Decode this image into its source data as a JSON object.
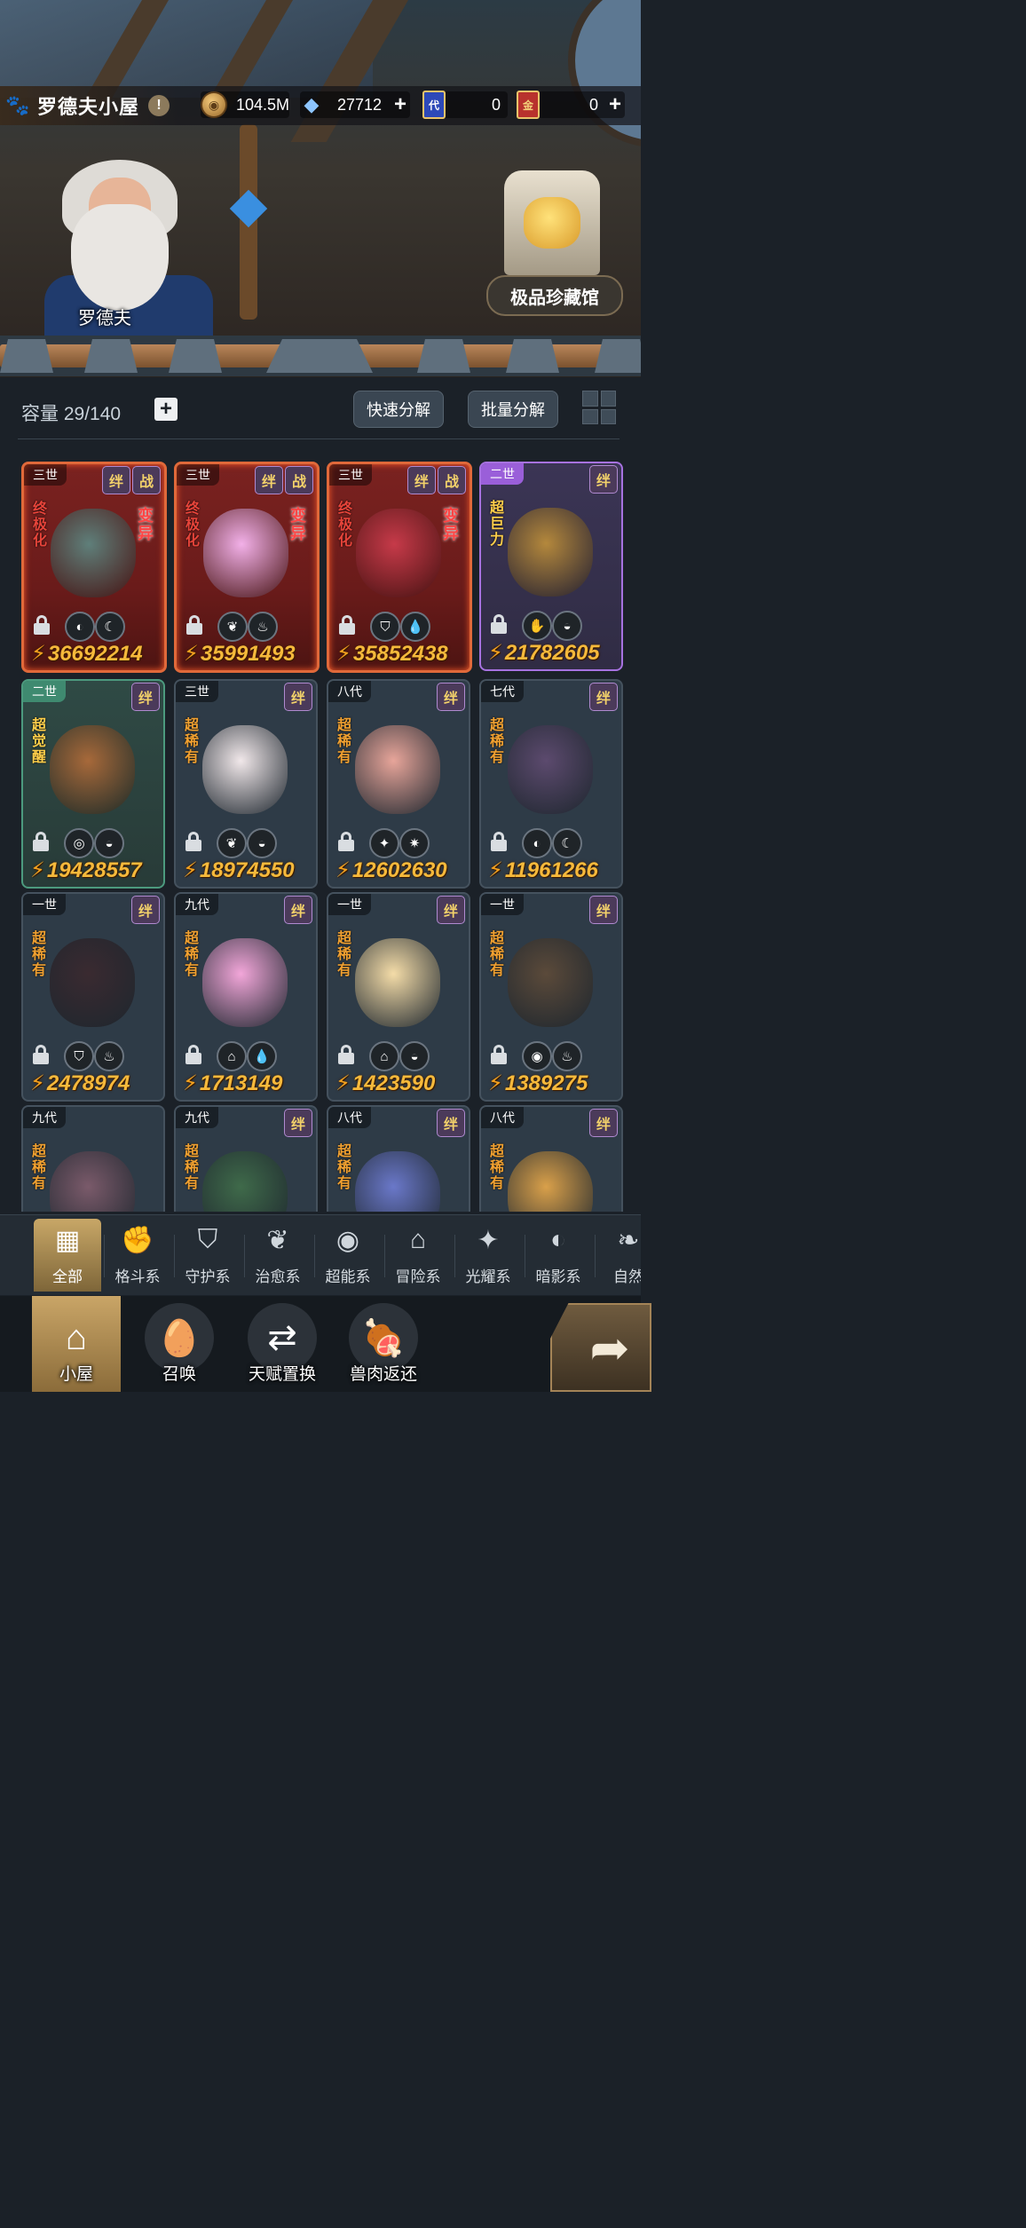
{
  "header": {
    "title": "罗德夫小屋",
    "resources": [
      {
        "name": "gold",
        "value": "104.5M",
        "icon": "gold-coin-icon"
      },
      {
        "name": "crystal",
        "value": "27712",
        "icon": "crystal-icon",
        "plus": "+"
      },
      {
        "name": "blue-ticket",
        "value": "0",
        "icon": "blue-ticket-icon",
        "badge": "代"
      },
      {
        "name": "red-ticket",
        "value": "0",
        "icon": "red-ticket-icon",
        "badge": "金",
        "plus": "+"
      }
    ]
  },
  "scene": {
    "npc_name": "罗德夫",
    "museum_label": "极品珍藏馆"
  },
  "controls": {
    "capacity_label": "容量 29/140",
    "plus": "+",
    "quick_decompose": "快速分解",
    "batch_decompose": "批量分解"
  },
  "cards": [
    {
      "gen": "三世",
      "tags": [
        "绊",
        "战"
      ],
      "rarity": "终极化",
      "mutant": "变异",
      "style": "red",
      "power": "36692214",
      "elements": [
        "◐",
        "☾"
      ],
      "color": "#5f7f7a"
    },
    {
      "gen": "三世",
      "tags": [
        "绊",
        "战"
      ],
      "rarity": "终极化",
      "mutant": "变异",
      "style": "red",
      "power": "35991493",
      "elements": [
        "❦",
        "♨"
      ],
      "color": "#f2b0e8"
    },
    {
      "gen": "三世",
      "tags": [
        "绊",
        "战"
      ],
      "rarity": "终极化",
      "mutant": "变异",
      "style": "red",
      "power": "35852438",
      "elements": [
        "⛉",
        "💧"
      ],
      "color": "#c63a49"
    },
    {
      "gen": "二世",
      "tags": [
        "绊"
      ],
      "rarity": "超巨力",
      "mutant": "",
      "style": "purple",
      "power": "21782605",
      "elements": [
        "✋",
        "◒"
      ],
      "color": "#b4883c"
    },
    {
      "gen": "二世",
      "tags": [
        "绊"
      ],
      "rarity": "超觉醒",
      "mutant": "",
      "style": "green",
      "power": "19428557",
      "elements": [
        "◎",
        "◒"
      ],
      "color": "#a7693a"
    },
    {
      "gen": "三世",
      "tags": [
        "绊"
      ],
      "rarity": "超稀有",
      "mutant": "",
      "style": "",
      "power": "18974550",
      "elements": [
        "❦",
        "◒"
      ],
      "color": "#f1e8ea"
    },
    {
      "gen": "八代",
      "tags": [
        "绊"
      ],
      "rarity": "超稀有",
      "mutant": "",
      "style": "",
      "power": "12602630",
      "elements": [
        "✦",
        "✷"
      ],
      "color": "#e7a59a"
    },
    {
      "gen": "七代",
      "tags": [
        "绊"
      ],
      "rarity": "超稀有",
      "mutant": "",
      "style": "",
      "power": "11961266",
      "elements": [
        "◐",
        "☾"
      ],
      "color": "#5c4a6e"
    },
    {
      "gen": "一世",
      "tags": [
        "绊"
      ],
      "rarity": "超稀有",
      "mutant": "",
      "style": "",
      "power": "2478974",
      "elements": [
        "⛉",
        "♨"
      ],
      "color": "#3a2a30"
    },
    {
      "gen": "九代",
      "tags": [
        "绊"
      ],
      "rarity": "超稀有",
      "mutant": "",
      "style": "",
      "power": "1713149",
      "elements": [
        "⌂",
        "💧"
      ],
      "color": "#f2a6d9"
    },
    {
      "gen": "一世",
      "tags": [
        "绊"
      ],
      "rarity": "超稀有",
      "mutant": "",
      "style": "",
      "power": "1423590",
      "elements": [
        "⌂",
        "◒"
      ],
      "color": "#f4dca8"
    },
    {
      "gen": "一世",
      "tags": [
        "绊"
      ],
      "rarity": "超稀有",
      "mutant": "",
      "style": "",
      "power": "1389275",
      "elements": [
        "◉",
        "♨"
      ],
      "color": "#5b4a3a"
    },
    {
      "gen": "九代",
      "tags": [],
      "rarity": "超稀有",
      "mutant": "",
      "style": "",
      "power": "",
      "elements": [],
      "color": "#7a5a6a"
    },
    {
      "gen": "九代",
      "tags": [
        "绊"
      ],
      "rarity": "超稀有",
      "mutant": "",
      "style": "",
      "power": "",
      "elements": [],
      "color": "#3f6a4a"
    },
    {
      "gen": "八代",
      "tags": [
        "绊"
      ],
      "rarity": "超稀有",
      "mutant": "",
      "style": "",
      "power": "",
      "elements": [],
      "color": "#6a78c9"
    },
    {
      "gen": "八代",
      "tags": [
        "绊"
      ],
      "rarity": "超稀有",
      "mutant": "",
      "style": "",
      "power": "",
      "elements": [],
      "color": "#d9a04a"
    }
  ],
  "filters": [
    {
      "label": "全部",
      "icon": "▦",
      "active": true
    },
    {
      "label": "格斗系",
      "icon": "✊"
    },
    {
      "label": "守护系",
      "icon": "⛉"
    },
    {
      "label": "治愈系",
      "icon": "❦"
    },
    {
      "label": "超能系",
      "icon": "◉"
    },
    {
      "label": "冒险系",
      "icon": "⌂"
    },
    {
      "label": "光耀系",
      "icon": "✦"
    },
    {
      "label": "暗影系",
      "icon": "◐"
    },
    {
      "label": "自然",
      "icon": "❧"
    }
  ],
  "nav": [
    {
      "label": "小屋",
      "icon": "⌂",
      "active": true
    },
    {
      "label": "召唤",
      "icon": "🥚"
    },
    {
      "label": "天赋置换",
      "icon": "⇄"
    },
    {
      "label": "兽肉返还",
      "icon": "🍖"
    }
  ],
  "next_arrow": "➦"
}
